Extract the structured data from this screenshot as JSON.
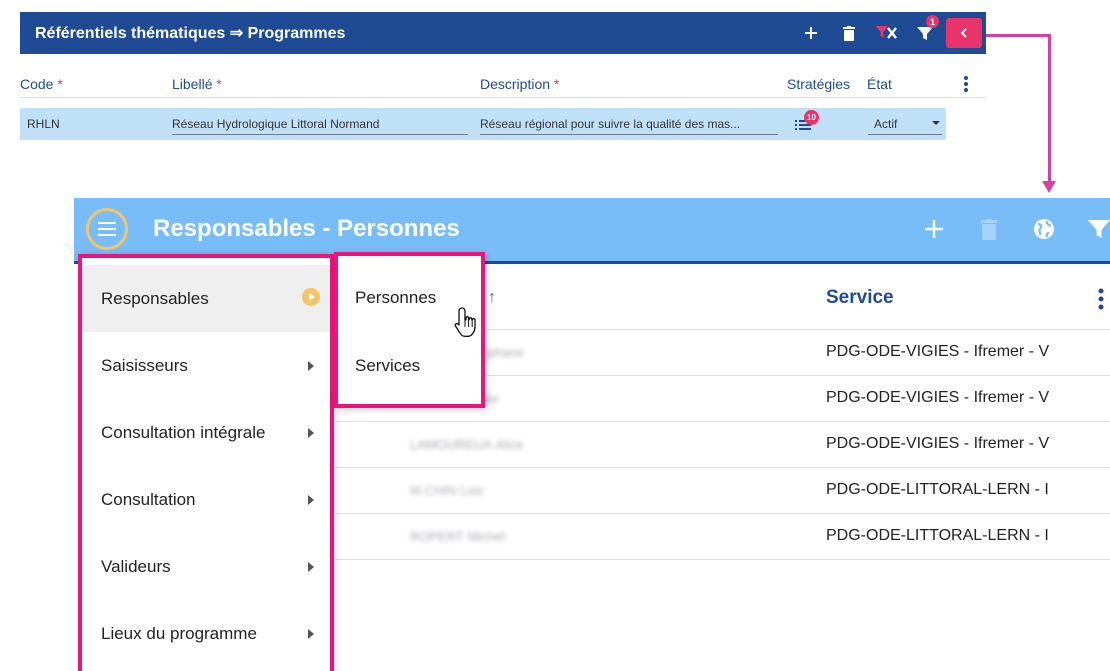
{
  "top_panel": {
    "title": "Référentiels thématiques ⇒ Programmes",
    "filter_badge": "1",
    "columns": {
      "code": "Code",
      "libelle": "Libellé",
      "description": "Description",
      "strategies": "Stratégies",
      "etat": "État",
      "required_mark": "*"
    },
    "row": {
      "code": "RHLN",
      "libelle": "Réseau Hydrologique Littoral Normand",
      "description": "Réseau régional pour suivre la qualité des mas...",
      "strategies_count": "10",
      "etat": "Actif"
    }
  },
  "bottom_panel": {
    "title": "Responsables - Personnes",
    "column_service": "Service",
    "rows": [
      {
        "name": "DUPONT Stéphane",
        "service": "PDG-ODE-VIGIES - Ifremer - V"
      },
      {
        "name": "MARTIN Emilie",
        "service": "PDG-ODE-VIGIES - Ifremer - V"
      },
      {
        "name": "LAMOUREUX Alice",
        "service": "PDG-ODE-VIGIES - Ifremer - V"
      },
      {
        "name": "M.CHIN Loïc",
        "service": "PDG-ODE-LITTORAL-LERN - I"
      },
      {
        "name": "ROPERT Michel",
        "service": "PDG-ODE-LITTORAL-LERN - I"
      }
    ],
    "menu": {
      "items": [
        {
          "label": "Responsables"
        },
        {
          "label": "Saisisseurs"
        },
        {
          "label": "Consultation intégrale"
        },
        {
          "label": "Consultation"
        },
        {
          "label": "Valideurs"
        },
        {
          "label": "Lieux du programme"
        }
      ],
      "submenu": [
        {
          "label": "Personnes"
        },
        {
          "label": "Services"
        }
      ]
    }
  },
  "colors": {
    "top_header": "#1f4a94",
    "bottom_header": "#78bdf8",
    "highlight_border": "#e8157d",
    "connector": "#d63fa7",
    "badge": "#e8336b",
    "selected_row": "#bfe0f7",
    "menu_indicator": "#f5c36a"
  },
  "icons": [
    "plus-icon",
    "trash-icon",
    "clear-filter-icon",
    "filter-icon",
    "collapse-left-icon",
    "menu-icon",
    "globe-icon",
    "sort-asc-icon",
    "more-vert-icon",
    "list-icon",
    "hand-pointer-icon"
  ]
}
